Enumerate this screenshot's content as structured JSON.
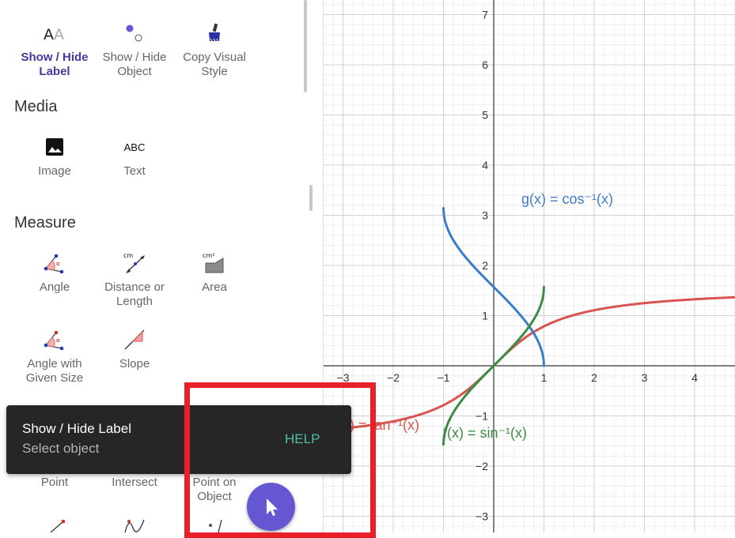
{
  "sidebar": {
    "edit_tools": [
      {
        "label_line1": "Show / Hide",
        "label_line2": "Label",
        "icon": "aa-label-icon",
        "active": true
      },
      {
        "label_line1": "Show / Hide",
        "label_line2": "Object",
        "icon": "show-hide-object-icon",
        "active": false
      },
      {
        "label_line1": "Copy Visual",
        "label_line2": "Style",
        "icon": "brush-icon",
        "active": false
      }
    ],
    "media": {
      "title": "Media",
      "tools": [
        {
          "label": "Image",
          "icon": "image-icon"
        },
        {
          "label": "Text",
          "icon": "text-icon",
          "glyph": "ABC"
        }
      ]
    },
    "measure": {
      "title": "Measure",
      "tools": [
        {
          "label_line1": "Angle",
          "label_line2": "",
          "icon": "angle-icon"
        },
        {
          "label_line1": "Distance or",
          "label_line2": "Length",
          "icon": "distance-icon",
          "unit": "cm"
        },
        {
          "label_line1": "Area",
          "label_line2": "",
          "icon": "area-icon",
          "unit": "cm²"
        },
        {
          "label_line1": "Angle with",
          "label_line2": "Given Size",
          "icon": "angle-given-size-icon"
        },
        {
          "label_line1": "Slope",
          "label_line2": "",
          "icon": "slope-icon"
        }
      ]
    },
    "point_tools": [
      {
        "label_line1": "Point",
        "label_line2": ""
      },
      {
        "label_line1": "Intersect",
        "label_line2": ""
      },
      {
        "label_line1": "Point on",
        "label_line2": "Object"
      }
    ]
  },
  "toast": {
    "title": "Show / Hide Label",
    "subtitle": "Select object",
    "help": "HELP"
  },
  "graph": {
    "x_ticks": [
      "−3",
      "−2",
      "−1",
      "1",
      "2",
      "3",
      "4"
    ],
    "y_ticks": [
      "7",
      "6",
      "5",
      "4",
      "3",
      "2",
      "1",
      "−1",
      "−2",
      "−3"
    ],
    "curves": [
      {
        "name": "g",
        "label": "g(x) = cos⁻¹(x)",
        "color": "#3a7dc9"
      },
      {
        "name": "f",
        "label": "f(x) = sin⁻¹(x)",
        "color": "#3c8c46"
      },
      {
        "name": "h",
        "label": "h(x) = tan⁻¹(x)",
        "color": "#d9534f"
      }
    ]
  },
  "colors": {
    "accent": "#4936a0",
    "fab": "#6557d2",
    "highlight_box": "#e8202a",
    "help": "#4cbfa5"
  }
}
